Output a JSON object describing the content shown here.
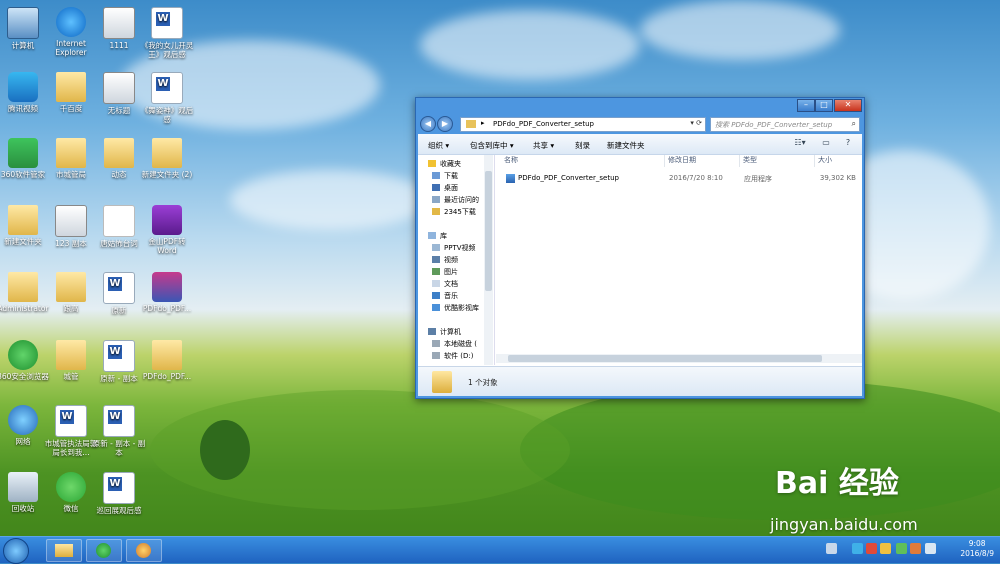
{
  "desktop": {
    "icons": [
      {
        "label": "计算机"
      },
      {
        "label": "Internet Explorer"
      },
      {
        "label": "1111"
      },
      {
        "label": "《我的女儿开灵王》观后感"
      },
      {
        "label": "腾讯视频"
      },
      {
        "label": "千百度"
      },
      {
        "label": "无标题"
      },
      {
        "label": "《舞姿神》观后感"
      },
      {
        "label": "360软件管家"
      },
      {
        "label": "市城管局"
      },
      {
        "label": "动态"
      },
      {
        "label": "新建文件夹 (2)"
      },
      {
        "label": "新建文件夹"
      },
      {
        "label": "123 副本"
      },
      {
        "label": "唐姑怖台词"
      },
      {
        "label": "金山PDF转Word"
      },
      {
        "label": "Administrator"
      },
      {
        "label": "跟高"
      },
      {
        "label": "原新"
      },
      {
        "label": "PDFdo_PDF..."
      },
      {
        "label": "360安全浏览器"
      },
      {
        "label": "城管"
      },
      {
        "label": "原新 - 副本"
      },
      {
        "label": "PDFdo_PDF..."
      },
      {
        "label": "网络"
      },
      {
        "label": "市城管执法局郭局长到我..."
      },
      {
        "label": "原新 - 副本 - 副本"
      },
      {
        "label": "回收站"
      },
      {
        "label": "微信"
      },
      {
        "label": "巡回展观后感"
      }
    ]
  },
  "window": {
    "address_path": "PDFdo_PDF_Converter_setup",
    "search_placeholder": "搜索 PDFdo_PDF_Converter_setup",
    "toolbar": {
      "organize": "组织",
      "include_in_library": "包含到库中",
      "share": "共享",
      "burn": "刻录",
      "new_folder": "新建文件夹"
    },
    "nav": {
      "favorites": "收藏夹",
      "fav_items": [
        "下载",
        "桌面",
        "最近访问的",
        "2345下载"
      ],
      "library": "库",
      "lib_items": [
        "PPTV视频",
        "视频",
        "图片",
        "文档",
        "音乐",
        "优酷影视库"
      ],
      "computer": "计算机",
      "comp_items": [
        "本地磁盘 (",
        "软件 (D:)"
      ]
    },
    "columns": {
      "name": "名称",
      "date": "修改日期",
      "type": "类型",
      "size": "大小"
    },
    "files": [
      {
        "name": "PDFdo_PDF_Converter_setup",
        "date": "2016/7/20 8:10",
        "type": "应用程序",
        "size": "39,302 KB"
      }
    ],
    "status_text": "1 个对象"
  },
  "watermark": {
    "brand": "Bai 经验",
    "url": "jingyan.baidu.com"
  },
  "taskbar": {
    "time": "9:08",
    "date": "2016/8/9"
  }
}
